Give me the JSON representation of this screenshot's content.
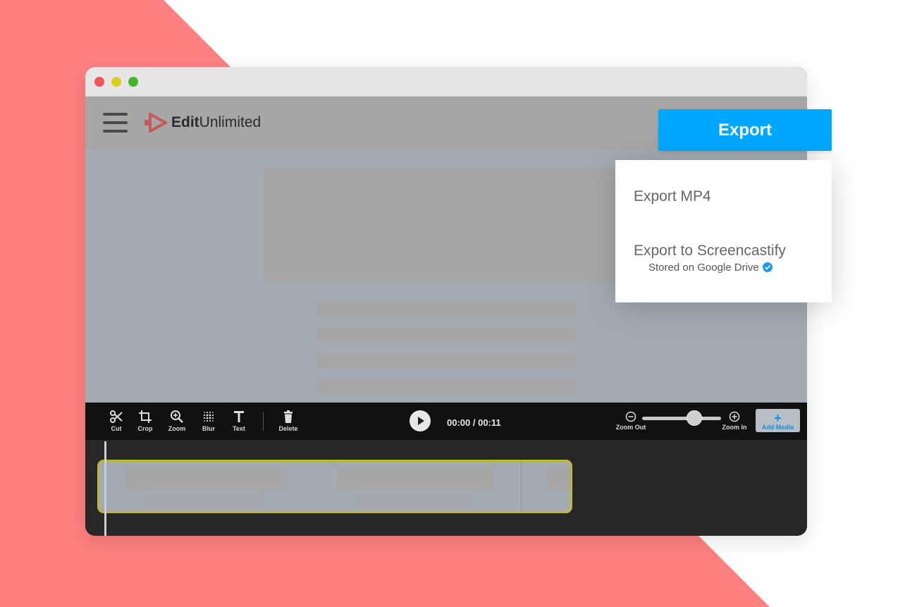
{
  "app": {
    "logo_bold": "Edit",
    "logo_regular": "Unlimited",
    "logo_icon": "play-arrow-logo-icon",
    "menu_icon": "hamburger-icon"
  },
  "colors": {
    "background_accent": "#ff8080",
    "export_button": "#00a7ff",
    "clip_border": "#bfb835",
    "add_media_text": "#1b8fd6"
  },
  "toolbar": {
    "tools": [
      {
        "label": "Cut",
        "icon": "scissors-icon"
      },
      {
        "label": "Crop",
        "icon": "crop-icon"
      },
      {
        "label": "Zoom",
        "icon": "zoom-icon"
      },
      {
        "label": "Blur",
        "icon": "blur-icon"
      },
      {
        "label": "Text",
        "icon": "text-icon"
      },
      {
        "label": "Delete",
        "icon": "trash-icon"
      }
    ],
    "timecode": "00:00 / 00:11",
    "zoom_out_label": "Zoom Out",
    "zoom_in_label": "Zoom In",
    "zoom_level": 0.65,
    "add_media_label": "Add Media"
  },
  "export": {
    "button_label": "Export",
    "menu": {
      "mp4_label": "Export MP4",
      "screencastify_label": "Export to Screencastify",
      "screencastify_sub": "Stored on Google Drive"
    }
  }
}
